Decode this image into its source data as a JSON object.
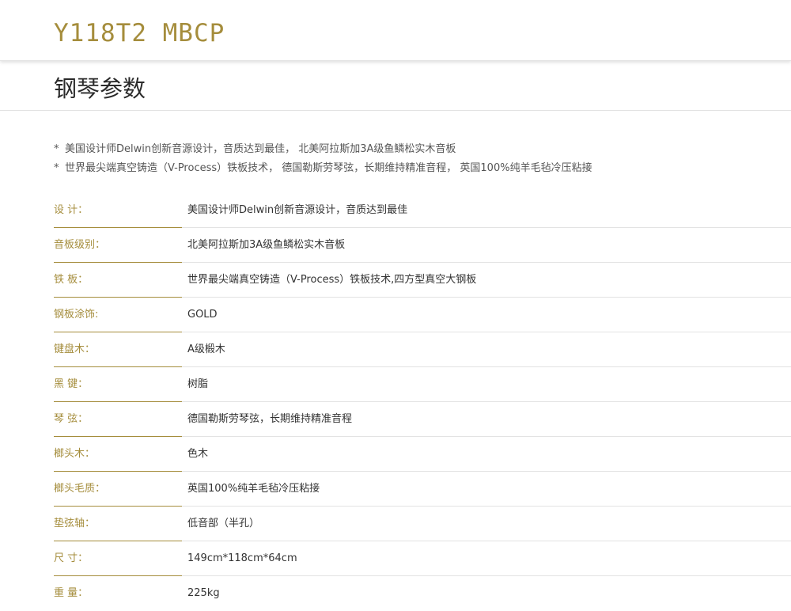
{
  "header": {
    "model": "Y118T2 MBCP"
  },
  "section": {
    "title": "钢琴参数"
  },
  "features": [
    "美国设计师Delwin创新音源设计，音质达到最佳， 北美阿拉斯加3A级鱼鳞松实木音板",
    "世界最尖端真空铸造（V-Process）铁板技术， 德国勒斯劳琴弦，长期维持精准音程， 英国100%纯羊毛毡冷压粘接"
  ],
  "feature_bullet": "*",
  "specs": [
    {
      "label": "设  计：",
      "value": "美国设计师Delwin创新音源设计，音质达到最佳"
    },
    {
      "label": "音板级别：",
      "value": "北美阿拉斯加3A级鱼鳞松实木音板"
    },
    {
      "label": "铁  板：",
      "value": "世界最尖端真空铸造（V-Process）铁板技术,四方型真空大钢板"
    },
    {
      "label": "钢板涂饰:",
      "value": "GOLD"
    },
    {
      "label": "键盘木：",
      "value": "A级椴木"
    },
    {
      "label": "黑  键：",
      "value": "树脂"
    },
    {
      "label": "琴  弦：",
      "value": "德国勒斯劳琴弦，长期维持精准音程"
    },
    {
      "label": "榔头木：",
      "value": "色木"
    },
    {
      "label": "榔头毛质：",
      "value": "英国100%纯羊毛毡冷压粘接"
    },
    {
      "label": "垫弦轴：",
      "value": "低音部（半孔）"
    },
    {
      "label": "尺  寸：",
      "value": "149cm*118cm*64cm"
    },
    {
      "label": "重  量：",
      "value": "225kg"
    }
  ],
  "colors": {
    "accent": "#a58d3c",
    "text": "#333333",
    "divider": "#e3e3e3"
  }
}
